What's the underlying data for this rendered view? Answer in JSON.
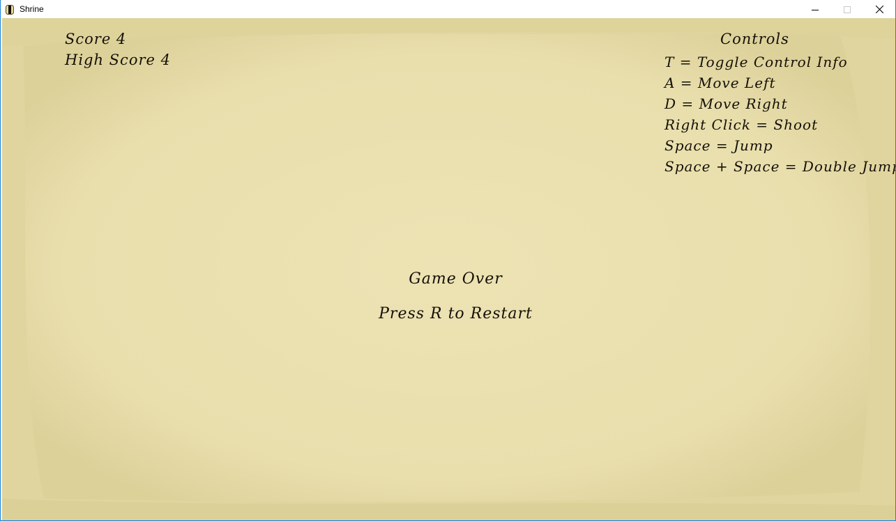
{
  "window": {
    "title": "Shrine",
    "app_icon": "shrine-app-icon",
    "buttons": {
      "minimize_icon": "minimize-icon",
      "maximize_icon": "maximize-icon",
      "close_icon": "close-icon"
    }
  },
  "colors": {
    "parchment": "#e4d9a3",
    "parchment_light": "#ede3b6",
    "text": "#141008",
    "desktop_accent": "#0078d7"
  },
  "hud": {
    "score": "Score 4",
    "high_score": "High Score 4"
  },
  "controls": {
    "title": "Controls",
    "items": [
      "T = Toggle Control Info",
      "A = Move Left",
      "D = Move Right",
      "Right Click = Shoot",
      "Space = Jump",
      "Space + Space = Double Jump"
    ]
  },
  "status": {
    "game_over": "Game Over",
    "restart_prompt": "Press R to Restart"
  }
}
